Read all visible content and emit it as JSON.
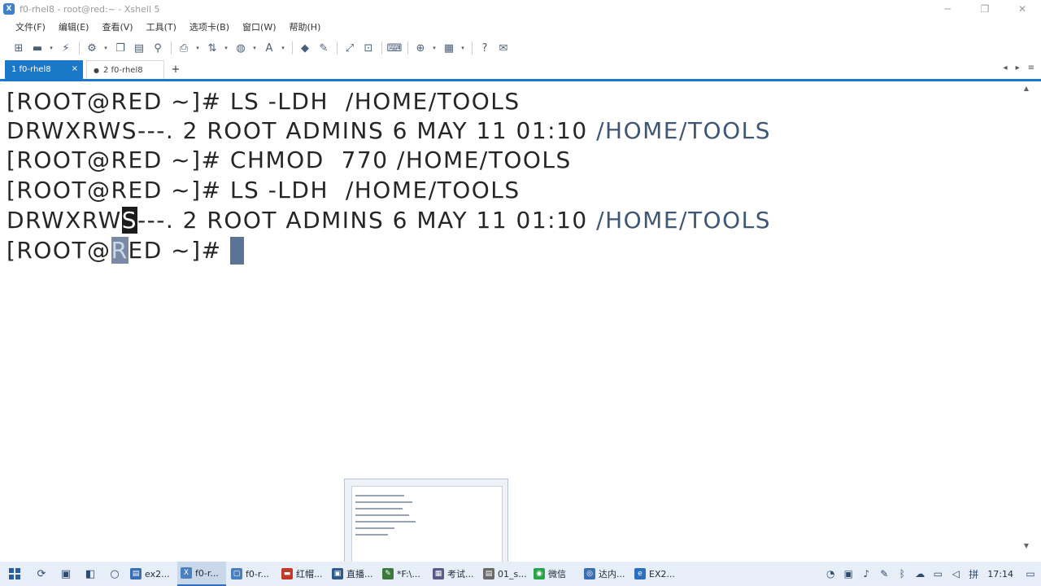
{
  "window": {
    "title": "f0-rhel8 - root@red:~ - Xshell 5",
    "app_icon": "X",
    "minimize": "─",
    "maximize": "❐",
    "close": "✕"
  },
  "menu": {
    "items": [
      "文件(F)",
      "编辑(E)",
      "查看(V)",
      "工具(T)",
      "选项卡(B)",
      "窗口(W)",
      "帮助(H)"
    ]
  },
  "toolbar": {
    "icons": [
      "new-session-icon",
      "open-folder-icon",
      "disconnect-icon",
      "properties-icon",
      "copy-icon",
      "paste-icon",
      "find-icon",
      "print-icon",
      "transfer-icon",
      "globe-icon",
      "font-icon",
      "xftp-icon",
      "key-icon",
      "fullscreen-icon",
      "lock-icon",
      "keyboard-icon",
      "add-icon",
      "layout-icon",
      "help-icon",
      "chat-icon"
    ]
  },
  "tabs": [
    {
      "label": "1 f0-rhel8",
      "active": true,
      "close": "×"
    },
    {
      "label": "2 f0-rhel8",
      "active": false
    }
  ],
  "tab_add": "+",
  "tab_nav": {
    "prev": "◂",
    "next": "▸",
    "menu": "≡"
  },
  "terminal": {
    "line1": {
      "prompt": "[ROOT@RED ~]# ",
      "cmd": "LS -LDH  /HOME/TOOLS"
    },
    "line2": {
      "text": "DRWXRWS---. 2 ROOT ADMINS 6 MAY 11 01:10 ",
      "path": "/HOME/TOOLS"
    },
    "line3": {
      "prompt": "[ROOT@RED ~]# ",
      "cmd": "CHMOD  770 /HOME/TOOLS"
    },
    "line4": {
      "prompt": "[ROOT@RED ~]# ",
      "cmd": "LS -LDH  /HOME/TOOLS"
    },
    "line5": {
      "pre": "DRWXRW",
      "hl": "S",
      "post": "---. 2 ROOT ADMINS 6 MAY 11 01:10 ",
      "path": "/HOME/TOOLS"
    },
    "line6": {
      "pre": "[ROOT@",
      "sel": "R",
      "post": "ED ~]# "
    }
  },
  "taskbar": {
    "tasks": [
      {
        "label": "ex2...",
        "color": "#3a6fb5",
        "active": false
      },
      {
        "label": "f0-r...",
        "color": "#4a7fc0",
        "active": true
      },
      {
        "label": "f0-r...",
        "color": "#4a7fc0",
        "active": false
      },
      {
        "label": "红帽...",
        "color": "#c0392b",
        "active": false
      },
      {
        "label": "直播...",
        "color": "#2d5a8a",
        "active": false
      },
      {
        "label": "*F:\\...",
        "color": "#3c7a3c",
        "active": false
      },
      {
        "label": "考试...",
        "color": "#5b5b8a",
        "active": false
      },
      {
        "label": "01_s...",
        "color": "#6a6a6a",
        "active": false
      },
      {
        "label": "微信",
        "color": "#2aa34a",
        "active": false
      },
      {
        "label": "达内...",
        "color": "#3a6fb5",
        "active": false
      },
      {
        "label": "EX2...",
        "color": "#2f6fc0",
        "active": false
      }
    ],
    "clock": "17:14"
  }
}
